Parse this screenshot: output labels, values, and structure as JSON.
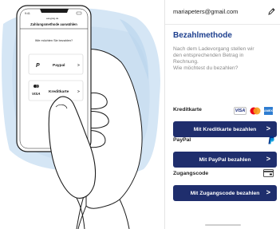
{
  "illustration": {
    "phone_time": "9:41",
    "phone_url": "easypkg.de",
    "screen_title": "Zahlungsmethode auswählen",
    "question": "Wie möchten Sie bezahlen?",
    "options": [
      {
        "label": "Paypal",
        "icon_text": "P"
      },
      {
        "label": "Kreditkarte",
        "icon_text": "VISA"
      }
    ],
    "chevron": ">"
  },
  "account": {
    "email": "mariapeters@gmail.com",
    "edit_icon": "pencil-icon"
  },
  "payment": {
    "title": "Bezahlmethode",
    "description_lines": [
      "Nach dem Ladevorgang stellen wir",
      "den entsprechenden Betrag in",
      "Rechnung.",
      "Wie möchtest du bezahlen?"
    ],
    "methods": [
      {
        "label": "Kreditkarte",
        "button": "Mit Kreditkarte bezahlen",
        "icons": [
          "visa-icon",
          "mastercard-icon",
          "amex-icon"
        ],
        "visa_text": "VISA",
        "amex_text": "AMEX"
      },
      {
        "label": "PayPal",
        "button": "Mit PayPal bezahlen",
        "icons": [
          "paypal-icon"
        ]
      },
      {
        "label": "Zugangscode",
        "button": "Mit Zugangscode bezahlen",
        "icons": [
          "access-card-icon"
        ]
      }
    ],
    "chevron": ">"
  },
  "colors": {
    "primary_button": "#1f2e6d",
    "title_blue": "#1d3f8e",
    "sketch_blue": "#cfe2f2",
    "mastercard_red": "#eb001b",
    "mastercard_orange": "#f79e1b",
    "paypal_dark": "#003087",
    "paypal_light": "#009cde"
  }
}
